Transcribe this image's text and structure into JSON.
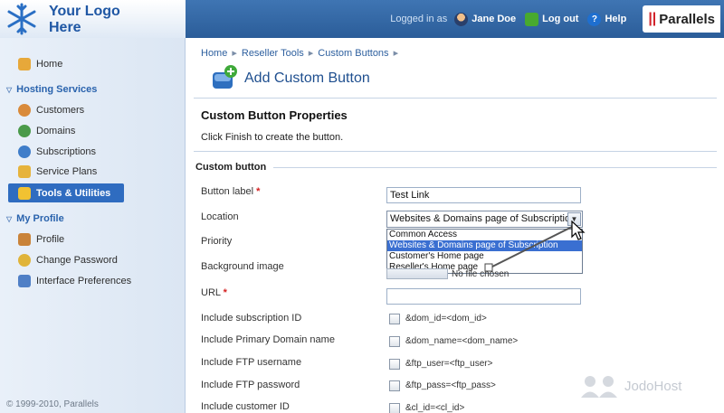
{
  "header": {
    "logo_line1": "Your Logo",
    "logo_line2": "Here",
    "logged_in_as": "Logged in as",
    "user_name": "Jane Doe",
    "logout_label": "Log out",
    "help_label": "Help",
    "brand": "Parallels",
    "brand_mark": "||"
  },
  "sidebar": {
    "home": "Home",
    "hosting_services": "Hosting Services",
    "customers": "Customers",
    "domains": "Domains",
    "subscriptions": "Subscriptions",
    "service_plans": "Service Plans",
    "tools_utilities": "Tools & Utilities",
    "my_profile": "My Profile",
    "profile": "Profile",
    "change_password": "Change Password",
    "interface_preferences": "Interface Preferences",
    "copyright": "© 1999-2010, Parallels"
  },
  "breadcrumb": [
    "Home",
    "Reseller Tools",
    "Custom Buttons"
  ],
  "page": {
    "title": "Add Custom Button",
    "props_title": "Custom Button Properties",
    "props_desc": "Click Finish to create the button.",
    "section": "Custom button"
  },
  "form": {
    "button_label": "Button label",
    "button_label_value": "Test Link",
    "location": "Location",
    "location_value": "Websites & Domains page of Subscription",
    "location_options": [
      "Common Access",
      "Websites & Domains page of Subscription",
      "Customer's Home page",
      "Reseller's Home page"
    ],
    "priority": "Priority",
    "background_image": "Background image",
    "no_file": "No file chosen",
    "url": "URL",
    "url_value": "",
    "required_mark": "*",
    "checkboxes": [
      {
        "label": "Include subscription ID",
        "param": "&dom_id=<dom_id>"
      },
      {
        "label": "Include Primary Domain name",
        "param": "&dom_name=<dom_name>"
      },
      {
        "label": "Include FTP username",
        "param": "&ftp_user=<ftp_user>"
      },
      {
        "label": "Include FTP password",
        "param": "&ftp_pass=<ftp_pass>"
      },
      {
        "label": "Include customer ID",
        "param": "&cl_id=<cl_id>"
      }
    ]
  },
  "watermark": "JodoHost",
  "colors": {
    "header_blue": "#2b5d99",
    "accent": "#2f6cc0",
    "selected_option": "#3a6fd1",
    "required": "#d42020"
  }
}
